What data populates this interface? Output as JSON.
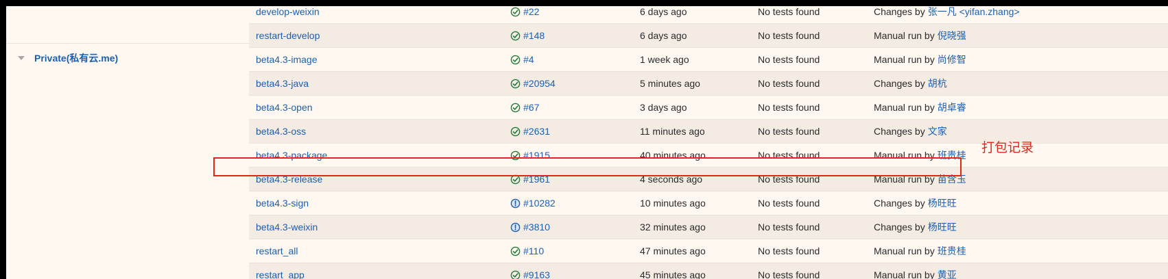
{
  "group": {
    "name": "Private(私有云.me)"
  },
  "annotation": "打包记录",
  "colors": {
    "link": "#1a5fb4",
    "success": "#1f7a3a",
    "annotation": "#e1251b"
  },
  "rows": [
    {
      "job": "develop-weixin",
      "status": "success",
      "build": "#22",
      "time": "6 days ago",
      "tests": "No tests found",
      "cause_prefix": "Changes by",
      "user": "张一凡 <yifan.zhang>"
    },
    {
      "job": "restart-develop",
      "status": "success",
      "build": "#148",
      "time": "6 days ago",
      "tests": "No tests found",
      "cause_prefix": "Manual run by",
      "user": "倪晓强"
    },
    {
      "job": "beta4.3-image",
      "status": "success",
      "build": "#4",
      "time": "1 week ago",
      "tests": "No tests found",
      "cause_prefix": "Manual run by",
      "user": "尚修智"
    },
    {
      "job": "beta4.3-java",
      "status": "success",
      "build": "#20954",
      "time": "5 minutes ago",
      "tests": "No tests found",
      "cause_prefix": "Changes by",
      "user": "胡杭"
    },
    {
      "job": "beta4.3-open",
      "status": "success",
      "build": "#67",
      "time": "3 days ago",
      "tests": "No tests found",
      "cause_prefix": "Manual run by",
      "user": "胡卓睿"
    },
    {
      "job": "beta4.3-oss",
      "status": "success",
      "build": "#2631",
      "time": "11 minutes ago",
      "tests": "No tests found",
      "cause_prefix": "Changes by",
      "user": "文家"
    },
    {
      "job": "beta4.3-package",
      "status": "success",
      "build": "#1915",
      "time": "40 minutes ago",
      "tests": "No tests found",
      "cause_prefix": "Manual run by",
      "user": "班贵桂"
    },
    {
      "job": "beta4.3-release",
      "status": "success",
      "build": "#1961",
      "time": "4 seconds ago",
      "tests": "No tests found",
      "cause_prefix": "Manual run by",
      "user": "苗含玉"
    },
    {
      "job": "beta4.3-sign",
      "status": "running",
      "build": "#10282",
      "time": "10 minutes ago",
      "tests": "No tests found",
      "cause_prefix": "Changes by",
      "user": "杨旺旺"
    },
    {
      "job": "beta4.3-weixin",
      "status": "running",
      "build": "#3810",
      "time": "32 minutes ago",
      "tests": "No tests found",
      "cause_prefix": "Changes by",
      "user": "杨旺旺"
    },
    {
      "job": "restart_all",
      "status": "success",
      "build": "#110",
      "time": "47 minutes ago",
      "tests": "No tests found",
      "cause_prefix": "Manual run by",
      "user": "班贵桂"
    },
    {
      "job": "restart_app",
      "status": "success",
      "build": "#9163",
      "time": "45 minutes ago",
      "tests": "No tests found",
      "cause_prefix": "Manual run by",
      "user": "黄亚"
    }
  ]
}
